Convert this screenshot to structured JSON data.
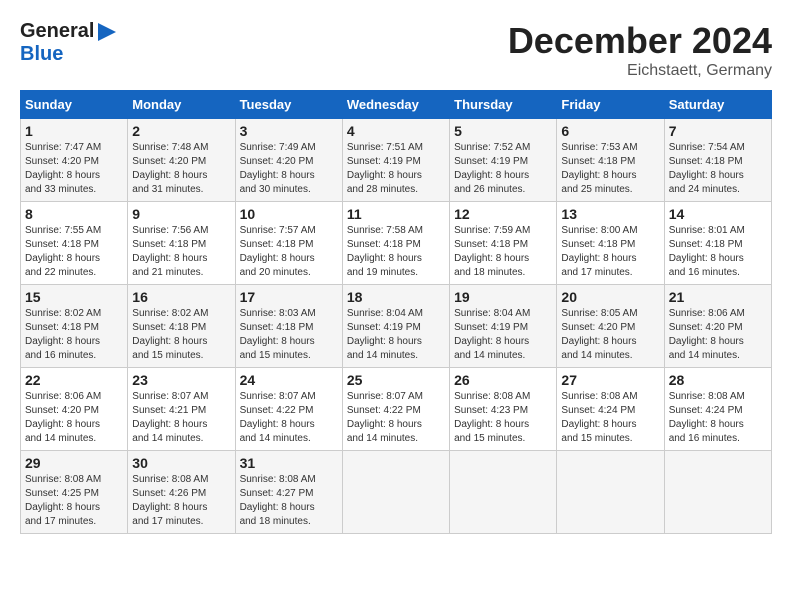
{
  "header": {
    "logo_general": "General",
    "logo_blue": "Blue",
    "month_title": "December 2024",
    "location": "Eichstaett, Germany"
  },
  "calendar": {
    "days_of_week": [
      "Sunday",
      "Monday",
      "Tuesday",
      "Wednesday",
      "Thursday",
      "Friday",
      "Saturday"
    ],
    "weeks": [
      [
        {
          "day": "",
          "info": ""
        },
        {
          "day": "2",
          "info": "Sunrise: 7:48 AM\nSunset: 4:20 PM\nDaylight: 8 hours\nand 31 minutes."
        },
        {
          "day": "3",
          "info": "Sunrise: 7:49 AM\nSunset: 4:20 PM\nDaylight: 8 hours\nand 30 minutes."
        },
        {
          "day": "4",
          "info": "Sunrise: 7:51 AM\nSunset: 4:19 PM\nDaylight: 8 hours\nand 28 minutes."
        },
        {
          "day": "5",
          "info": "Sunrise: 7:52 AM\nSunset: 4:19 PM\nDaylight: 8 hours\nand 26 minutes."
        },
        {
          "day": "6",
          "info": "Sunrise: 7:53 AM\nSunset: 4:18 PM\nDaylight: 8 hours\nand 25 minutes."
        },
        {
          "day": "7",
          "info": "Sunrise: 7:54 AM\nSunset: 4:18 PM\nDaylight: 8 hours\nand 24 minutes."
        }
      ],
      [
        {
          "day": "1",
          "info": "Sunrise: 7:47 AM\nSunset: 4:20 PM\nDaylight: 8 hours\nand 33 minutes."
        },
        {
          "day": "",
          "info": ""
        },
        {
          "day": "",
          "info": ""
        },
        {
          "day": "",
          "info": ""
        },
        {
          "day": "",
          "info": ""
        },
        {
          "day": "",
          "info": ""
        },
        {
          "day": "",
          "info": ""
        }
      ],
      [
        {
          "day": "8",
          "info": "Sunrise: 7:55 AM\nSunset: 4:18 PM\nDaylight: 8 hours\nand 22 minutes."
        },
        {
          "day": "9",
          "info": "Sunrise: 7:56 AM\nSunset: 4:18 PM\nDaylight: 8 hours\nand 21 minutes."
        },
        {
          "day": "10",
          "info": "Sunrise: 7:57 AM\nSunset: 4:18 PM\nDaylight: 8 hours\nand 20 minutes."
        },
        {
          "day": "11",
          "info": "Sunrise: 7:58 AM\nSunset: 4:18 PM\nDaylight: 8 hours\nand 19 minutes."
        },
        {
          "day": "12",
          "info": "Sunrise: 7:59 AM\nSunset: 4:18 PM\nDaylight: 8 hours\nand 18 minutes."
        },
        {
          "day": "13",
          "info": "Sunrise: 8:00 AM\nSunset: 4:18 PM\nDaylight: 8 hours\nand 17 minutes."
        },
        {
          "day": "14",
          "info": "Sunrise: 8:01 AM\nSunset: 4:18 PM\nDaylight: 8 hours\nand 16 minutes."
        }
      ],
      [
        {
          "day": "15",
          "info": "Sunrise: 8:02 AM\nSunset: 4:18 PM\nDaylight: 8 hours\nand 16 minutes."
        },
        {
          "day": "16",
          "info": "Sunrise: 8:02 AM\nSunset: 4:18 PM\nDaylight: 8 hours\nand 15 minutes."
        },
        {
          "day": "17",
          "info": "Sunrise: 8:03 AM\nSunset: 4:18 PM\nDaylight: 8 hours\nand 15 minutes."
        },
        {
          "day": "18",
          "info": "Sunrise: 8:04 AM\nSunset: 4:19 PM\nDaylight: 8 hours\nand 14 minutes."
        },
        {
          "day": "19",
          "info": "Sunrise: 8:04 AM\nSunset: 4:19 PM\nDaylight: 8 hours\nand 14 minutes."
        },
        {
          "day": "20",
          "info": "Sunrise: 8:05 AM\nSunset: 4:20 PM\nDaylight: 8 hours\nand 14 minutes."
        },
        {
          "day": "21",
          "info": "Sunrise: 8:06 AM\nSunset: 4:20 PM\nDaylight: 8 hours\nand 14 minutes."
        }
      ],
      [
        {
          "day": "22",
          "info": "Sunrise: 8:06 AM\nSunset: 4:20 PM\nDaylight: 8 hours\nand 14 minutes."
        },
        {
          "day": "23",
          "info": "Sunrise: 8:07 AM\nSunset: 4:21 PM\nDaylight: 8 hours\nand 14 minutes."
        },
        {
          "day": "24",
          "info": "Sunrise: 8:07 AM\nSunset: 4:22 PM\nDaylight: 8 hours\nand 14 minutes."
        },
        {
          "day": "25",
          "info": "Sunrise: 8:07 AM\nSunset: 4:22 PM\nDaylight: 8 hours\nand 14 minutes."
        },
        {
          "day": "26",
          "info": "Sunrise: 8:08 AM\nSunset: 4:23 PM\nDaylight: 8 hours\nand 15 minutes."
        },
        {
          "day": "27",
          "info": "Sunrise: 8:08 AM\nSunset: 4:24 PM\nDaylight: 8 hours\nand 15 minutes."
        },
        {
          "day": "28",
          "info": "Sunrise: 8:08 AM\nSunset: 4:24 PM\nDaylight: 8 hours\nand 16 minutes."
        }
      ],
      [
        {
          "day": "29",
          "info": "Sunrise: 8:08 AM\nSunset: 4:25 PM\nDaylight: 8 hours\nand 17 minutes."
        },
        {
          "day": "30",
          "info": "Sunrise: 8:08 AM\nSunset: 4:26 PM\nDaylight: 8 hours\nand 17 minutes."
        },
        {
          "day": "31",
          "info": "Sunrise: 8:08 AM\nSunset: 4:27 PM\nDaylight: 8 hours\nand 18 minutes."
        },
        {
          "day": "",
          "info": ""
        },
        {
          "day": "",
          "info": ""
        },
        {
          "day": "",
          "info": ""
        },
        {
          "day": "",
          "info": ""
        }
      ]
    ]
  }
}
